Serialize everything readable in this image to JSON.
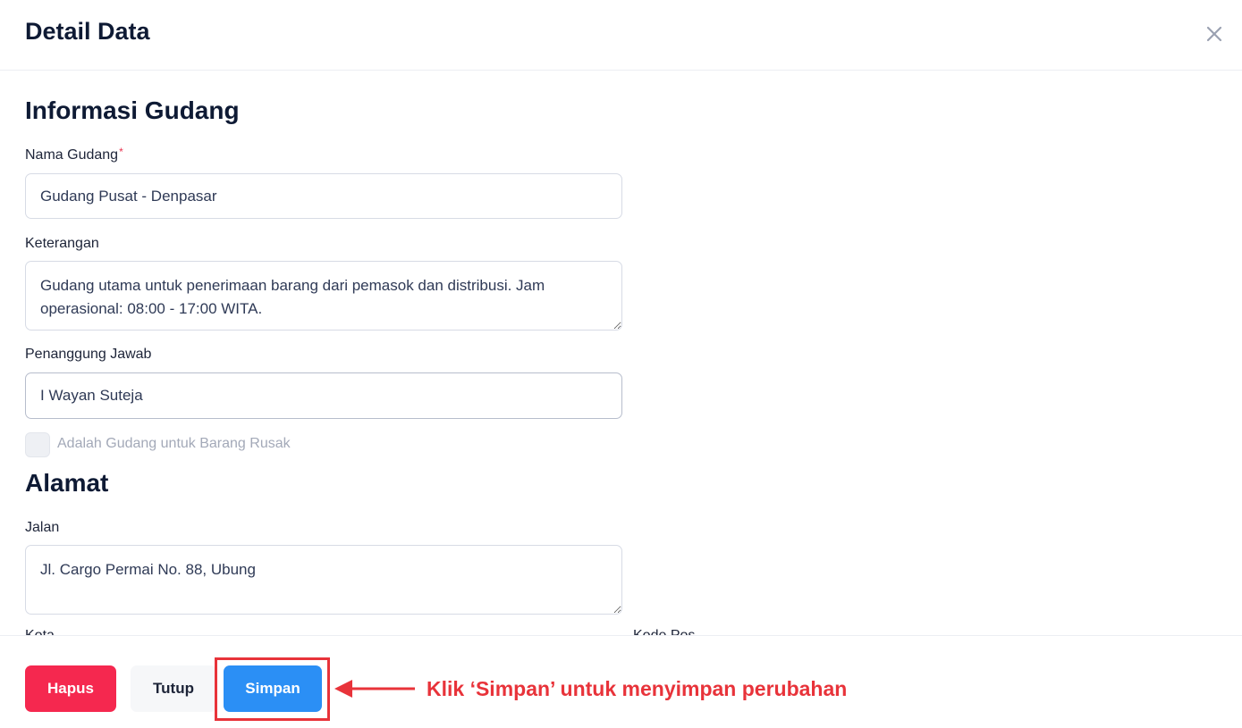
{
  "modal": {
    "title": "Detail Data"
  },
  "sections": {
    "info_title": "Informasi Gudang",
    "address_title": "Alamat"
  },
  "fields": {
    "nama_gudang": {
      "label": "Nama Gudang",
      "required_mark": "*",
      "value": "Gudang Pusat - Denpasar"
    },
    "keterangan": {
      "label": "Keterangan",
      "value": "Gudang utama untuk penerimaan barang dari pemasok dan distribusi. Jam operasional: 08:00 - 17:00 WITA."
    },
    "penanggung_jawab": {
      "label": "Penanggung Jawab",
      "value": "I Wayan Suteja"
    },
    "barang_rusak": {
      "label": "Adalah Gudang untuk Barang Rusak",
      "checked": false
    },
    "jalan": {
      "label": "Jalan",
      "value": "Jl. Cargo Permai No. 88, Ubung"
    },
    "kota": {
      "label": "Kota"
    },
    "kode_pos": {
      "label": "Kode Pos"
    }
  },
  "footer": {
    "delete_label": "Hapus",
    "close_label": "Tutup",
    "save_label": "Simpan"
  },
  "annotation": {
    "text": "Klik ‘Simpan’ untuk menyimpan perubahan"
  },
  "colors": {
    "danger": "#f5284f",
    "primary": "#2b8ff5",
    "annotation": "#e8333a",
    "heading": "#0e1a34"
  },
  "icons": {
    "close": "close-icon",
    "arrow": "arrow-left-icon"
  }
}
